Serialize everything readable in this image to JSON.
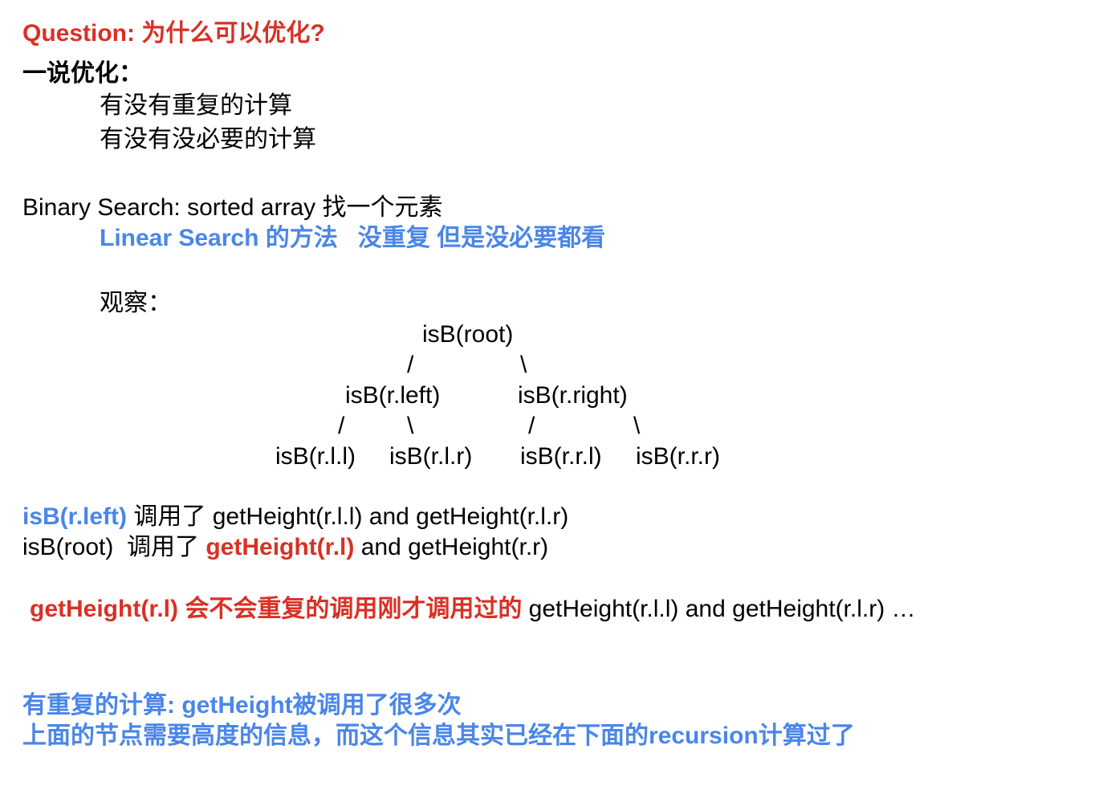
{
  "question": {
    "label": "Question: 为什么可以优化?",
    "color": "#d93025"
  },
  "optimize": {
    "heading": "一说优化：",
    "items": [
      "有没有重复的计算",
      "有没有没必要的计算"
    ]
  },
  "binary_search": {
    "line": "Binary Search: sorted array 找一个元素",
    "linear_note": "Linear Search 的方法   没重复 但是没必要都看"
  },
  "observe": {
    "label": "观察："
  },
  "tree": {
    "root": "isB(root)",
    "edge_root_left": "/",
    "edge_root_right": "\\",
    "left": "isB(r.left)",
    "right": "isB(r.right)",
    "edge_left_left": "/",
    "edge_left_right": "\\",
    "edge_right_left": "/",
    "edge_right_right": "\\",
    "ll": "isB(r.l.l)",
    "lr": "isB(r.l.r)",
    "rl": "isB(r.r.l)",
    "rr": "isB(r.r.r)"
  },
  "calls": {
    "line1_a": "isB(r.left)",
    "line1_b": " 调用了 getHeight(r.l.l) and getHeight(r.l.r)",
    "line2_a": "isB(root)  调用了 ",
    "line2_b": "getHeight(r.l)",
    "line2_c": " and getHeight(r.r)"
  },
  "repeat": {
    "part_a": "getHeight(r.l) 会不会重复的调用刚才调用过的",
    "part_b": " getHeight(r.l.l) and getHeight(r.l.r) …"
  },
  "conclusion": {
    "line1": "有重复的计算: getHeight被调用了很多次",
    "line2": "上面的节点需要高度的信息，而这个信息其实已经在下面的recursion计算过了"
  },
  "colors": {
    "red": "#d93025",
    "blue": "#4a86e8",
    "text": "#000000"
  }
}
